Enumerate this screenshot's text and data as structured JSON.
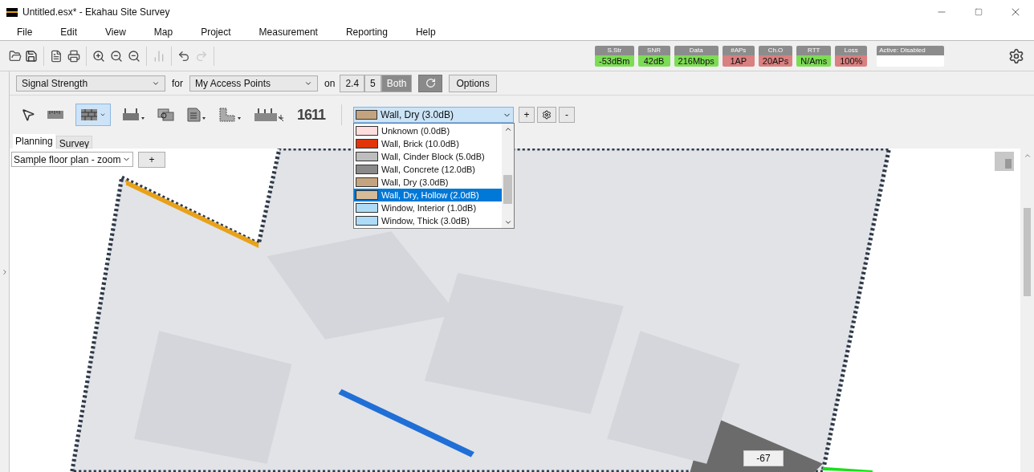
{
  "window": {
    "title": "Untitled.esx* - Ekahau Site Survey"
  },
  "menu": [
    "File",
    "Edit",
    "View",
    "Map",
    "Project",
    "Measurement",
    "Reporting",
    "Help"
  ],
  "meters": [
    {
      "label": "S.Str",
      "value": "-53dBm",
      "color": "#7ddc55"
    },
    {
      "label": "SNR",
      "value": "42dB",
      "color": "#7ddc55"
    },
    {
      "label": "Data",
      "value": "216Mbps",
      "color": "#7ddc55"
    },
    {
      "label": "#APs",
      "value": "1AP",
      "color": "#d98080"
    },
    {
      "label": "Ch.O",
      "value": "20APs",
      "color": "#d98080"
    },
    {
      "label": "RTT",
      "value": "N/Ams",
      "color": "#7ddc55"
    },
    {
      "label": "Loss",
      "value": "100%",
      "color": "#d98080"
    }
  ],
  "status_box": {
    "label": "Active: Disabled"
  },
  "visualization": {
    "view": "Signal Strength",
    "for_label": "for",
    "source": "My Access Points",
    "on_label": "on",
    "bands": [
      {
        "label": "2.4",
        "selected": false
      },
      {
        "label": "5",
        "selected": false
      },
      {
        "label": "Both",
        "selected": true
      }
    ],
    "options": "Options"
  },
  "wall_tools": {
    "label": "1611"
  },
  "wall_type": {
    "value": "Wall, Dry (3.0dB)",
    "color": "#c4a47f",
    "add": "+",
    "remove": "-",
    "options": [
      {
        "label": "Unknown (0.0dB)",
        "color": "#ffdede",
        "highlighted": false
      },
      {
        "label": "Wall, Brick (10.0dB)",
        "color": "#e0360a",
        "highlighted": false
      },
      {
        "label": "Wall, Cinder Block (5.0dB)",
        "color": "#bdbdbd",
        "highlighted": false
      },
      {
        "label": "Wall, Concrete (12.0dB)",
        "color": "#8a8a8a",
        "highlighted": false
      },
      {
        "label": "Wall, Dry (3.0dB)",
        "color": "#c4a47f",
        "highlighted": false
      },
      {
        "label": "Wall, Dry, Hollow (2.0dB)",
        "color": "#d6bb98",
        "highlighted": true
      },
      {
        "label": "Window, Interior (1.0dB)",
        "color": "#aedcf7",
        "highlighted": false
      },
      {
        "label": "Window, Thick (3.0dB)",
        "color": "#aedcf7",
        "highlighted": false
      }
    ]
  },
  "tabs": [
    {
      "label": "Planning",
      "selected": true
    },
    {
      "label": "Survey",
      "selected": false
    }
  ],
  "floor": {
    "value": "Sample floor plan - zoom",
    "add": "+"
  },
  "map": {
    "kind": "picture",
    "tooltip": "-67"
  }
}
